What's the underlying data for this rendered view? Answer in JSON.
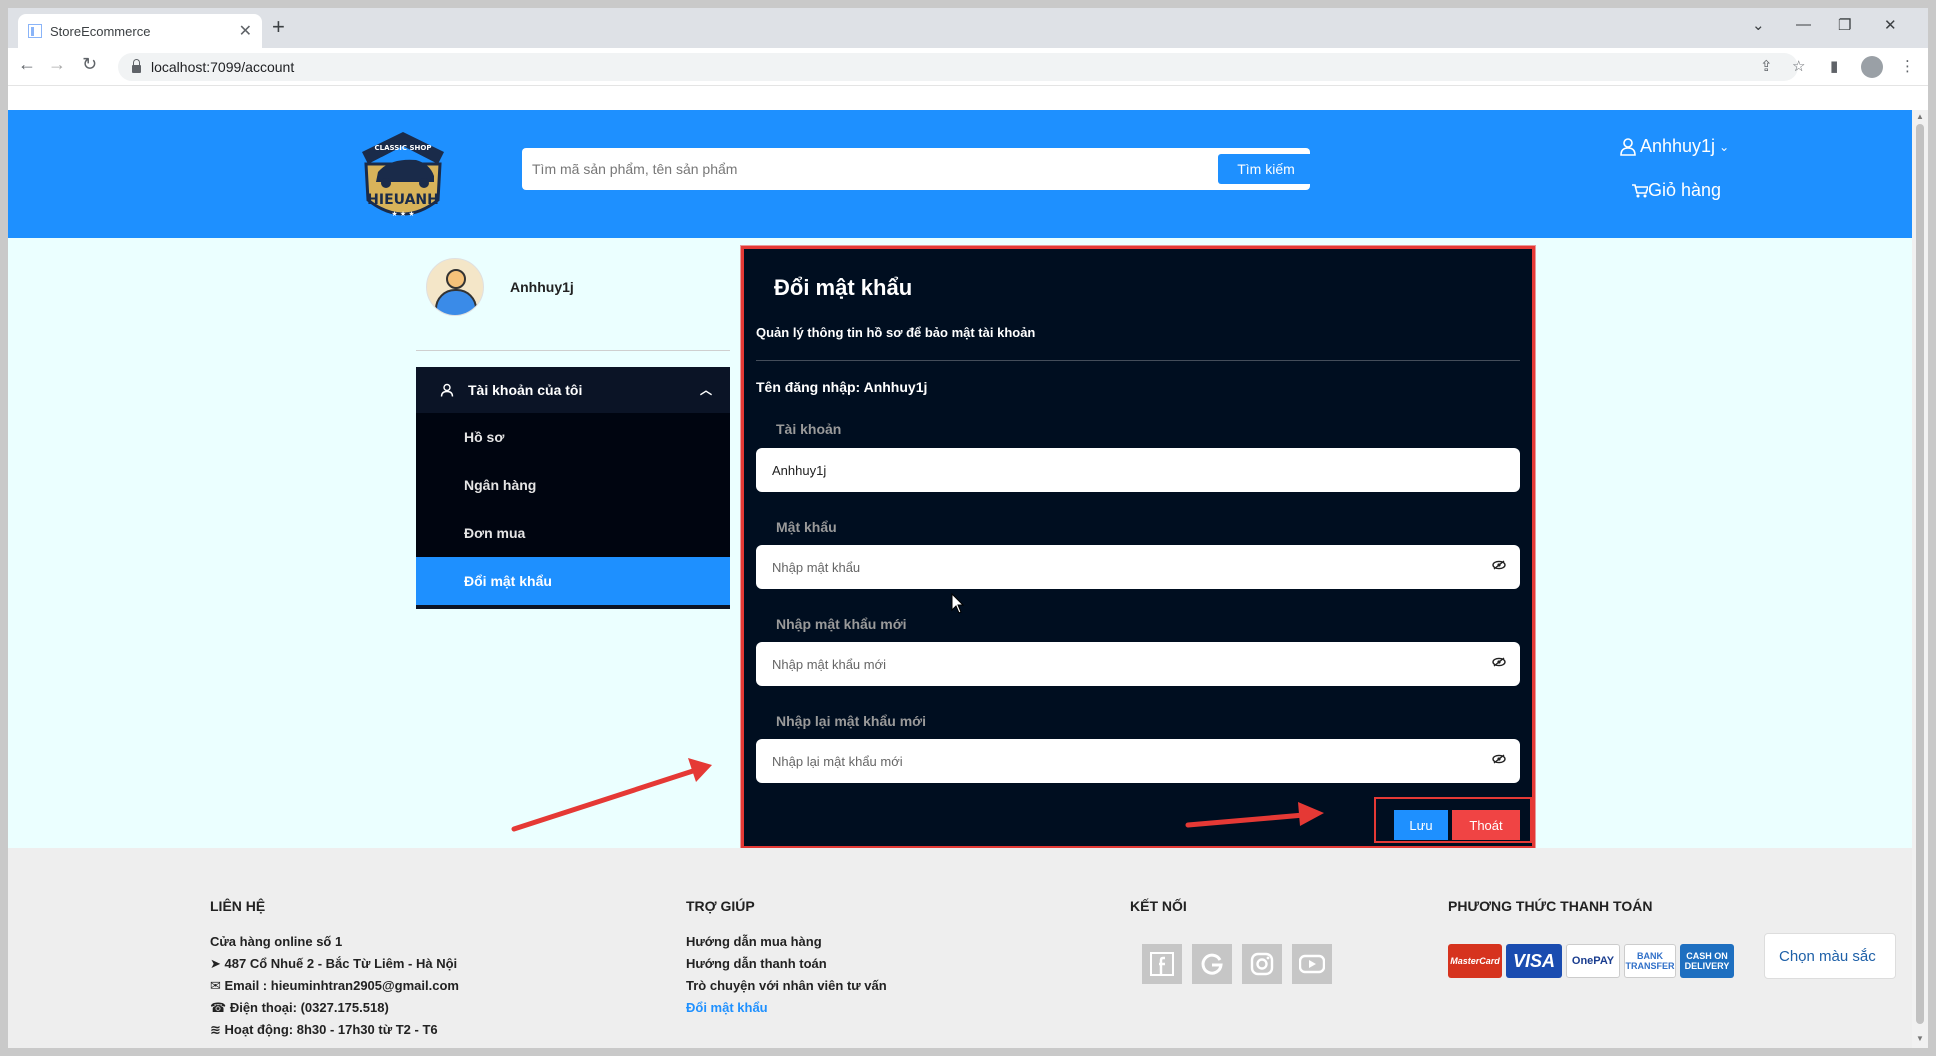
{
  "browser": {
    "tab_title": "StoreEcommerce",
    "url": "localhost:7099/account",
    "new_tab": "+",
    "close_tab": "✕"
  },
  "header": {
    "logo_top_text": "CLASSIC SHOP",
    "logo_main_text": "HIEUANH",
    "search_placeholder": "Tìm mã sản phẩm, tên sản phẩm",
    "search_button": "Tìm kiếm",
    "username": "Anhhuy1j",
    "cart": "Giỏ hàng"
  },
  "sidebar": {
    "profile_name": "Anhhuy1j",
    "section_title": "Tài khoản của tôi",
    "items": [
      {
        "label": "Hồ sơ"
      },
      {
        "label": "Ngân hàng"
      },
      {
        "label": "Đơn mua"
      },
      {
        "label": "Đổi mật khẩu"
      }
    ],
    "active_index": 3
  },
  "form": {
    "title": "Đổi mật khẩu",
    "subtitle": "Quản lý thông tin hồ sơ để bảo mật tài khoản",
    "login_name": "Tên đăng nhập: Anhhuy1j",
    "fields": [
      {
        "label": "Tài khoản",
        "value": "Anhhuy1j",
        "placeholder": ""
      },
      {
        "label": "Mật khẩu",
        "value": "",
        "placeholder": "Nhập mật khẩu"
      },
      {
        "label": "Nhập mật khẩu mới",
        "value": "",
        "placeholder": "Nhập mật khẩu mới"
      },
      {
        "label": "Nhập lại mật khẩu mới",
        "value": "",
        "placeholder": "Nhập lại mật khẩu mới"
      }
    ],
    "save_button": "Lưu",
    "exit_button": "Thoát"
  },
  "footer": {
    "contact": {
      "heading": "LIÊN HỆ",
      "store": "Cửa hàng online số 1",
      "address": "487 Cổ Nhuế 2 - Bắc Từ Liêm - Hà Nội",
      "email": "Email : hieuminhtran2905@gmail.com",
      "phone": "Điện thoại: (0327.175.518)",
      "hours": "Hoạt động: 8h30 - 17h30 từ T2 - T6"
    },
    "help": {
      "heading": "TRỢ GIÚP",
      "links": [
        "Hướng dẫn mua hàng",
        "Hướng dẫn thanh toán",
        "Trò chuyện với nhân viên tư vấn",
        "Đổi mật khẩu"
      ]
    },
    "connect": {
      "heading": "KẾT NỐI",
      "icons": [
        "facebook-icon",
        "google-icon",
        "instagram-icon",
        "youtube-icon"
      ]
    },
    "payment": {
      "heading": "PHƯƠNG THỨC THANH TOÁN",
      "methods": [
        "MasterCard",
        "VISA",
        "OnePAY",
        "BANK TRANSFER",
        "CASH ON DELIVERY"
      ]
    },
    "color_button": "Chọn màu sắc"
  },
  "colors": {
    "brand_blue": "#1e90ff",
    "panel_bg": "#000e20",
    "highlight_red": "#e53935",
    "exit_red": "#f04444",
    "page_bg": "#ebffff"
  }
}
